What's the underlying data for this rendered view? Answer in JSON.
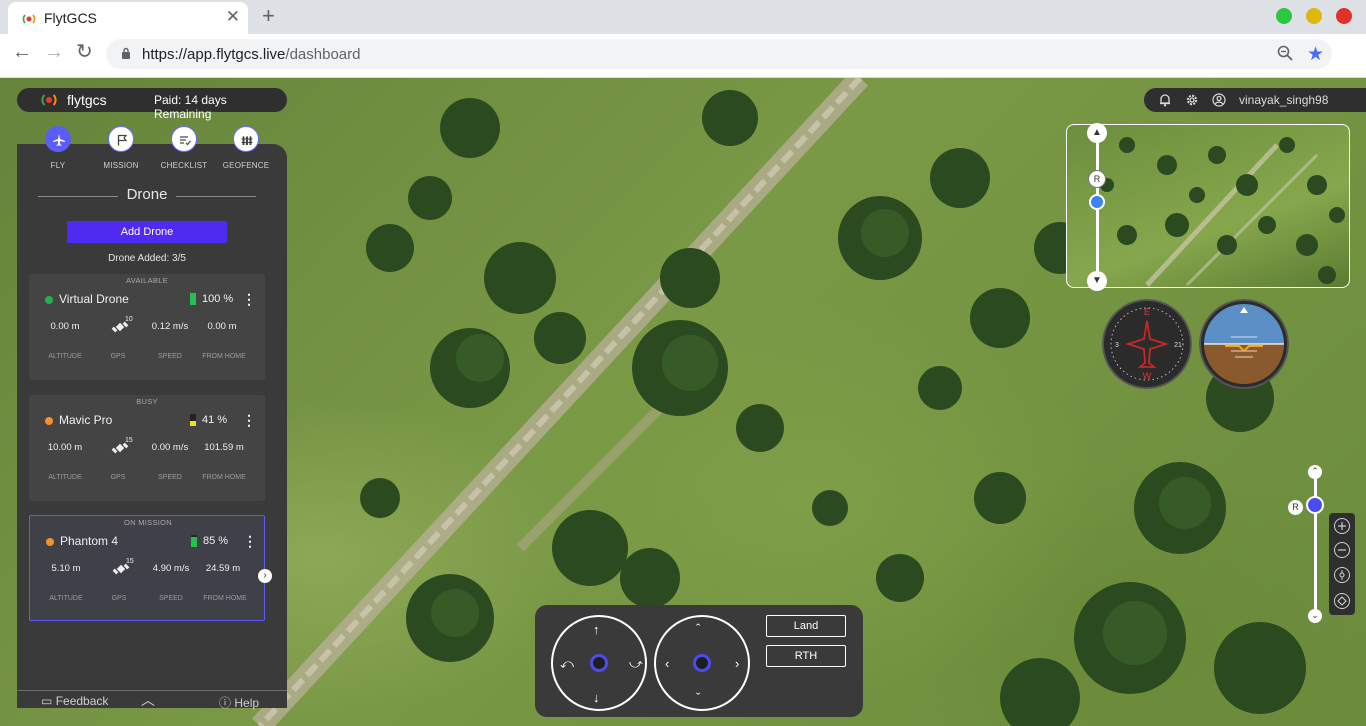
{
  "browser": {
    "tab_title": "FlytGCS",
    "url_host": "https://app.flytgcs.live",
    "url_path": "/dashboard",
    "window_buttons": {
      "green": "#2bc840",
      "yellow": "#e0b70f",
      "red": "#e0322d"
    }
  },
  "brand": {
    "logo_text": "flytgcs",
    "plan_text": "Paid: 14 days Remaining"
  },
  "user": {
    "username": "vinayak_singh98",
    "icons": [
      "bell-icon",
      "gear-icon",
      "user-icon"
    ]
  },
  "nav": {
    "items": [
      {
        "label": "FLY",
        "icon": "airplane-icon",
        "active": true
      },
      {
        "label": "MISSION",
        "icon": "flag-icon",
        "active": false
      },
      {
        "label": "CHECKLIST",
        "icon": "checklist-icon",
        "active": false
      },
      {
        "label": "GEOFENCE",
        "icon": "fence-icon",
        "active": false
      }
    ]
  },
  "panel": {
    "title": "Drone",
    "add_button": "Add Drone",
    "count_text": "Drone Added: 3/5",
    "stat_labels": [
      "ALTITUDE",
      "GPS",
      "SPEED",
      "FROM HOME"
    ]
  },
  "drones": [
    {
      "status": "AVAILABLE",
      "name": "Virtual Drone",
      "dot_color": "#22b24c",
      "battery": "100 %",
      "battery_fraction": 1.0,
      "battery_color": "#22c24c",
      "altitude": "0.00 m",
      "gps": "10",
      "speed": "0.12 m/s",
      "from_home": "0.00 m"
    },
    {
      "status": "BUSY",
      "name": "Mavic Pro",
      "dot_color": "#f5922a",
      "battery": "41 %",
      "battery_fraction": 0.41,
      "battery_color": "#f2e21a",
      "altitude": "10.00 m",
      "gps": "15",
      "speed": "0.00 m/s",
      "from_home": "101.59 m"
    },
    {
      "status": "ON MISSION",
      "name": "Phantom 4",
      "dot_color": "#f5922a",
      "battery": "85 %",
      "battery_fraction": 0.85,
      "battery_color": "#22c24c",
      "altitude": "5.10 m",
      "gps": "15",
      "speed": "4.90 m/s",
      "from_home": "24.59 m"
    }
  ],
  "footer": {
    "feedback": "Feedback",
    "help": "Help"
  },
  "preview": {
    "slider_label": "R"
  },
  "zoom": {
    "slider_label": "R",
    "controls": [
      "zoom-in-icon",
      "zoom-out-icon",
      "locate-icon",
      "layers-icon"
    ]
  },
  "controls": {
    "land": "Land",
    "rth": "RTH"
  }
}
